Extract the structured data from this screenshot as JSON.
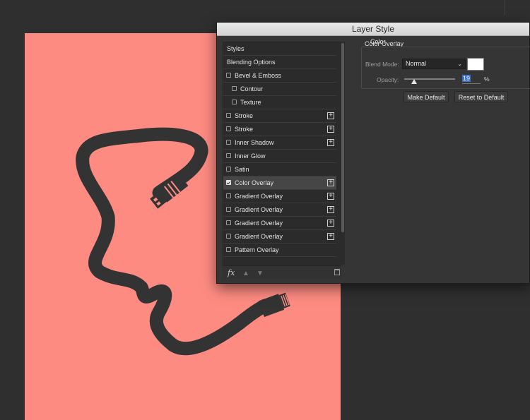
{
  "dialog": {
    "title": "Layer Style",
    "styles_list": [
      {
        "label": "Styles",
        "checkbox": false,
        "checked": false,
        "plus": false,
        "indent": "head",
        "selected": false
      },
      {
        "label": "Blending Options",
        "checkbox": false,
        "checked": false,
        "plus": false,
        "indent": "head",
        "selected": false
      },
      {
        "label": "Bevel & Emboss",
        "checkbox": true,
        "checked": false,
        "plus": false,
        "indent": "sub",
        "selected": false
      },
      {
        "label": "Contour",
        "checkbox": true,
        "checked": false,
        "plus": false,
        "indent": "subsub",
        "selected": false
      },
      {
        "label": "Texture",
        "checkbox": true,
        "checked": false,
        "plus": false,
        "indent": "subsub",
        "selected": false
      },
      {
        "label": "Stroke",
        "checkbox": true,
        "checked": false,
        "plus": true,
        "indent": "sub",
        "selected": false
      },
      {
        "label": "Stroke",
        "checkbox": true,
        "checked": false,
        "plus": true,
        "indent": "sub",
        "selected": false
      },
      {
        "label": "Inner Shadow",
        "checkbox": true,
        "checked": false,
        "plus": true,
        "indent": "sub",
        "selected": false
      },
      {
        "label": "Inner Glow",
        "checkbox": true,
        "checked": false,
        "plus": false,
        "indent": "sub",
        "selected": false
      },
      {
        "label": "Satin",
        "checkbox": true,
        "checked": false,
        "plus": false,
        "indent": "sub",
        "selected": false
      },
      {
        "label": "Color Overlay",
        "checkbox": true,
        "checked": true,
        "plus": true,
        "indent": "sub",
        "selected": true
      },
      {
        "label": "Gradient Overlay",
        "checkbox": true,
        "checked": false,
        "plus": true,
        "indent": "sub",
        "selected": false
      },
      {
        "label": "Gradient Overlay",
        "checkbox": true,
        "checked": false,
        "plus": true,
        "indent": "sub",
        "selected": false
      },
      {
        "label": "Gradient Overlay",
        "checkbox": true,
        "checked": false,
        "plus": true,
        "indent": "sub",
        "selected": false
      },
      {
        "label": "Gradient Overlay",
        "checkbox": true,
        "checked": false,
        "plus": true,
        "indent": "sub",
        "selected": false
      },
      {
        "label": "Pattern Overlay",
        "checkbox": true,
        "checked": false,
        "plus": false,
        "indent": "sub",
        "selected": false
      }
    ],
    "footer": {
      "fx_label": "fx",
      "up_icon": "arrow-up-icon",
      "down_icon": "arrow-down-icon",
      "trash_icon": "trash-icon"
    },
    "color_overlay": {
      "group_title": "Color Overlay",
      "sub_title": "Color",
      "blend_mode_label": "Blend Mode:",
      "blend_mode_value": "Normal",
      "swatch_color": "#ffffff",
      "opacity_label": "Opacity:",
      "opacity_value": "19",
      "opacity_unit": "%",
      "opacity_fraction": 0.19,
      "make_default_label": "Make Default",
      "reset_default_label": "Reset to Default"
    }
  },
  "canvas": {
    "background": "#fd8b82",
    "cable_color": "#333333"
  }
}
